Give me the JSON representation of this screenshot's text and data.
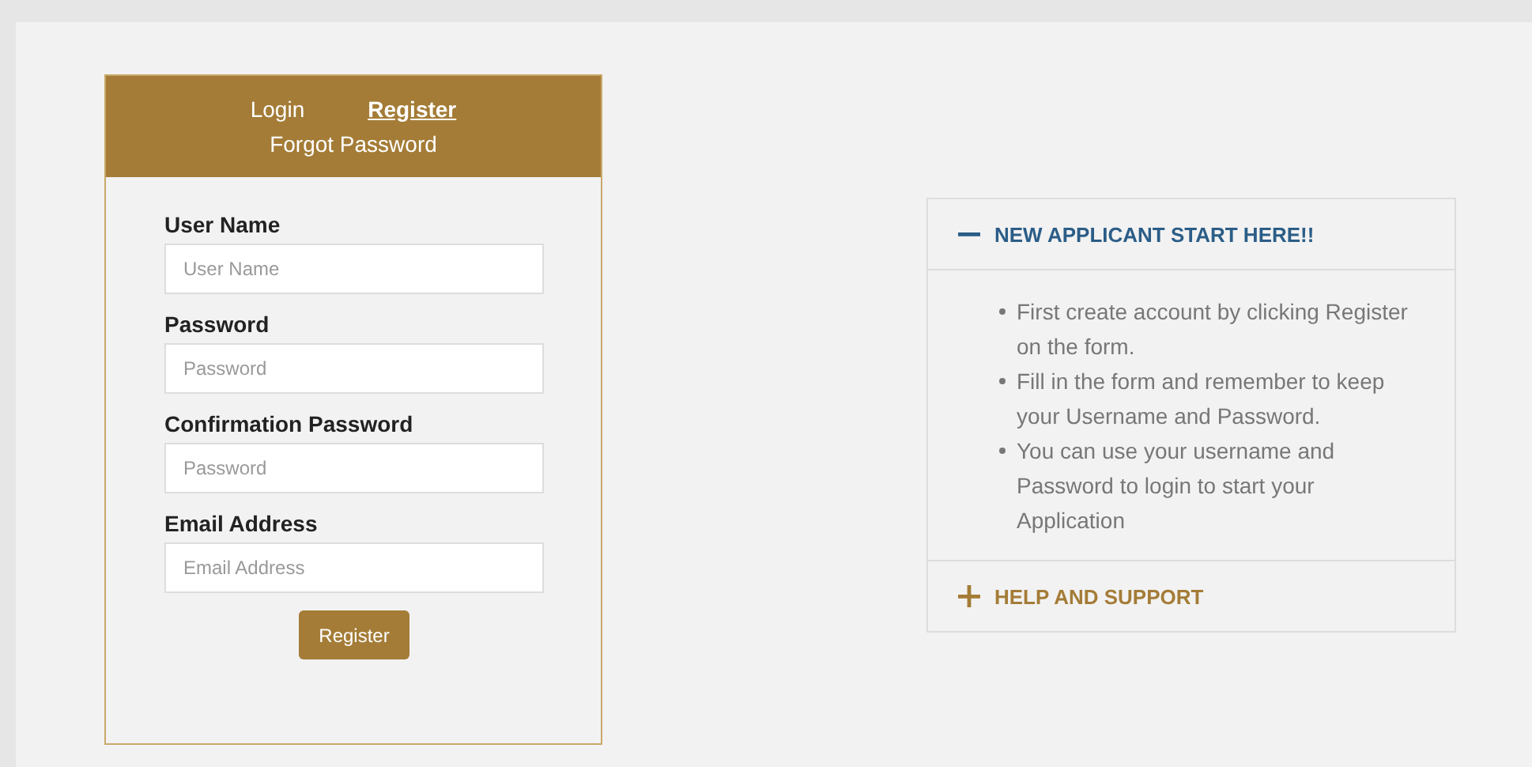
{
  "tabs": [
    {
      "label": "Login",
      "selected": false
    },
    {
      "label": "Register",
      "selected": true
    },
    {
      "label": "Forgot Password",
      "selected": false
    }
  ],
  "form": {
    "fields": [
      {
        "label": "User Name",
        "placeholder": "User Name"
      },
      {
        "label": "Password",
        "placeholder": "Password"
      },
      {
        "label": "Confirmation Password",
        "placeholder": "Password"
      },
      {
        "label": "Email Address",
        "placeholder": "Email Address"
      }
    ],
    "submit": "Register"
  },
  "accordion": [
    {
      "title": "NEW APPLICANT START HERE!!",
      "expanded": true,
      "items": [
        "First create account by clicking Register on the form.",
        "Fill in the form and remember to keep your Username and Password.",
        "You can use your username and Password to login to start your Application"
      ]
    },
    {
      "title": "HELP AND SUPPORT",
      "expanded": false
    }
  ]
}
